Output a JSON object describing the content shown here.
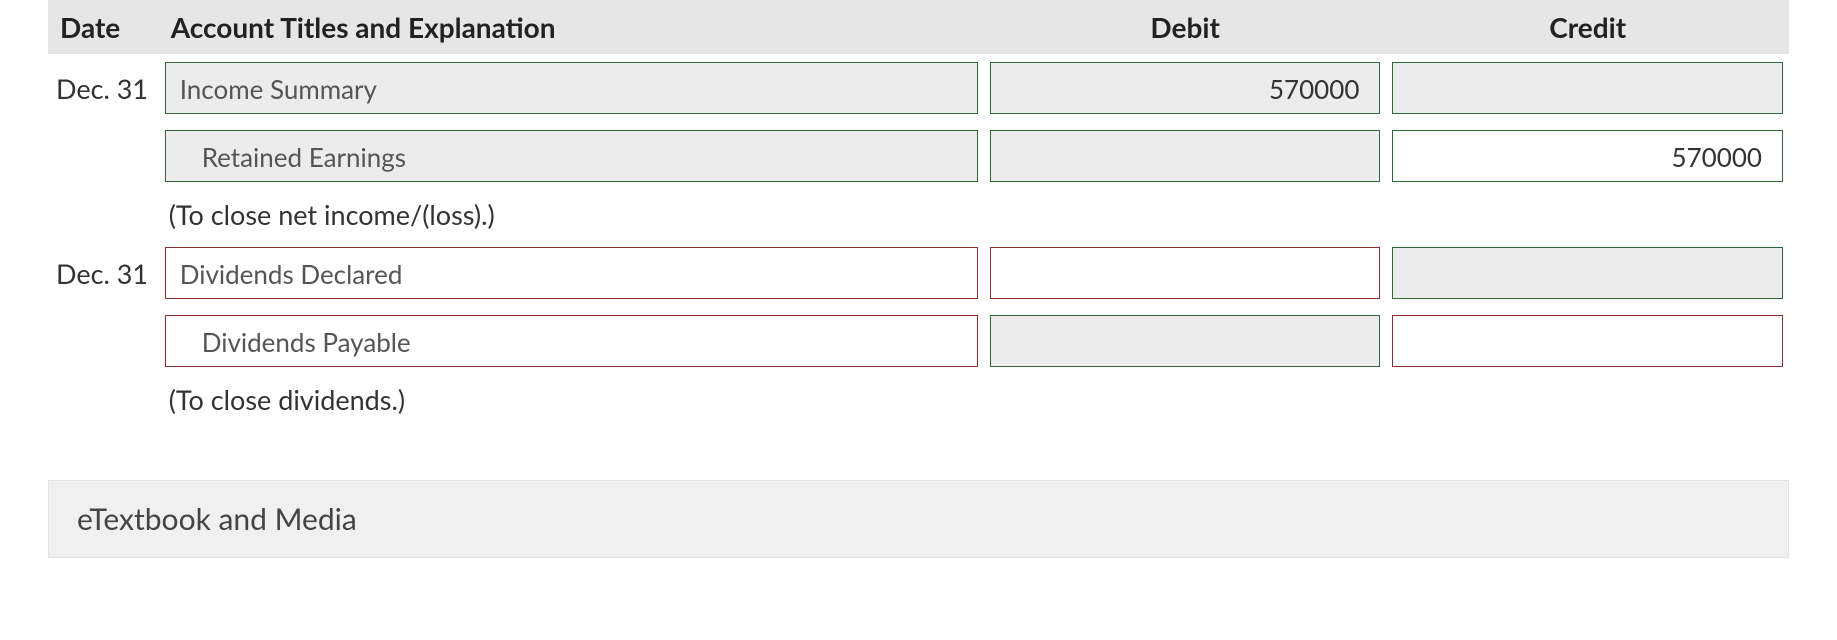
{
  "headers": {
    "date": "Date",
    "account": "Account Titles and Explanation",
    "debit": "Debit",
    "credit": "Credit"
  },
  "entries": [
    {
      "date": "Dec. 31",
      "lines": [
        {
          "account": "Income Summary",
          "indent": false,
          "debit": "570000",
          "credit": "",
          "acct_style": "green grey",
          "debit_style": "green grey",
          "credit_style": "green grey"
        },
        {
          "account": "Retained Earnings",
          "indent": true,
          "debit": "",
          "credit": "570000",
          "acct_style": "green grey",
          "debit_style": "green grey",
          "credit_style": "green"
        }
      ],
      "explanation": "(To close net income/(loss).)"
    },
    {
      "date": "Dec. 31",
      "lines": [
        {
          "account": "Dividends Declared",
          "indent": false,
          "debit": "",
          "credit": "",
          "acct_style": "red",
          "debit_style": "red",
          "credit_style": "green grey"
        },
        {
          "account": "Dividends Payable",
          "indent": true,
          "debit": "",
          "credit": "",
          "acct_style": "red",
          "debit_style": "green grey",
          "credit_style": "red"
        }
      ],
      "explanation": "(To close dividends.)"
    }
  ],
  "footer": "eTextbook and Media"
}
